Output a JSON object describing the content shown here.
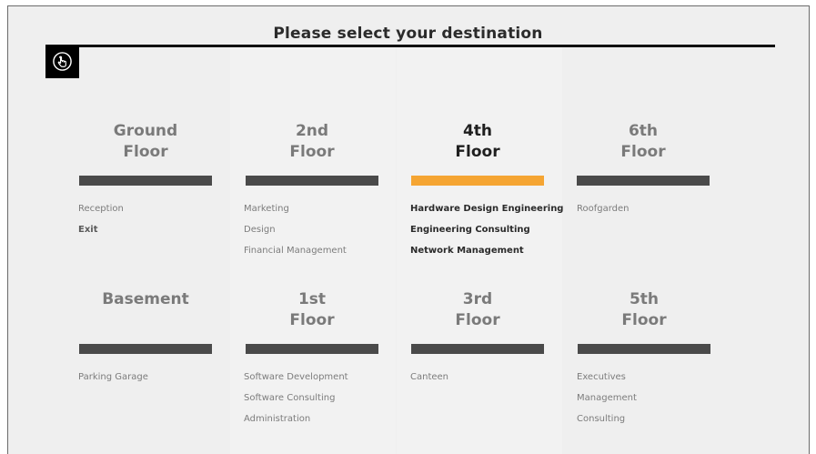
{
  "header": {
    "title": "Please select your destination"
  },
  "icons": {
    "touch": "touch-hand-icon"
  },
  "colors": {
    "accent": "#f5a533",
    "bar": "#4a4a4a",
    "background": "#efefef"
  },
  "floors": {
    "ground": {
      "line1": "Ground",
      "line2": "Floor",
      "departments": [
        "Reception",
        "Exit"
      ]
    },
    "second": {
      "line1": "2nd",
      "line2": "Floor",
      "departments": [
        "Marketing",
        "Design",
        "Financial Management"
      ]
    },
    "fourth": {
      "line1": "4th",
      "line2": "Floor",
      "selected": true,
      "departments": [
        "Hardware Design Engineering",
        "Engineering Consulting",
        "Network Management"
      ]
    },
    "sixth": {
      "line1": "6th",
      "line2": "Floor",
      "departments": [
        "Roofgarden"
      ]
    },
    "basement": {
      "line1": "Basement",
      "line2": "",
      "departments": [
        "Parking Garage"
      ]
    },
    "first": {
      "line1": "1st",
      "line2": "Floor",
      "departments": [
        "Software Development",
        "Software Consulting",
        "Administration"
      ]
    },
    "third": {
      "line1": "3rd",
      "line2": "Floor",
      "departments": [
        "Canteen"
      ]
    },
    "fifth": {
      "line1": "5th",
      "line2": "Floor",
      "departments": [
        "Executives",
        "Management",
        "Consulting"
      ]
    }
  }
}
